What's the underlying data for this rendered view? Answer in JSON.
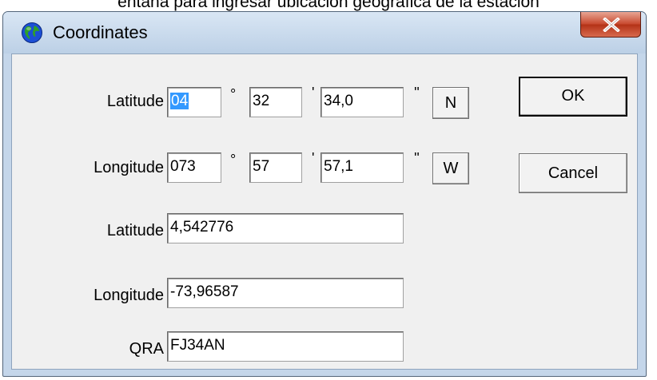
{
  "caption": "entana para ingresar ubicación geográfica de la estación",
  "window": {
    "title": "Coordinates",
    "close_label": "X"
  },
  "dms": {
    "latitude": {
      "label": "Latitude",
      "degrees": "04",
      "minutes": "32",
      "seconds": "34,0",
      "hemisphere": "N"
    },
    "longitude": {
      "label": "Longitude",
      "degrees": "073",
      "minutes": "57",
      "seconds": "57,1",
      "hemisphere": "W"
    },
    "degree_symbol": "°",
    "minute_symbol": "'",
    "second_symbol": "''"
  },
  "decimal": {
    "latitude_label": "Latitude",
    "latitude_value": "4,542776",
    "longitude_label": "Longitude",
    "longitude_value": "-73,96587"
  },
  "qra": {
    "label": "QRA",
    "value": "FJ34AN"
  },
  "buttons": {
    "ok": "OK",
    "cancel": "Cancel"
  },
  "colors": {
    "selection": "#3399ff",
    "close_button": "#c7472c"
  }
}
